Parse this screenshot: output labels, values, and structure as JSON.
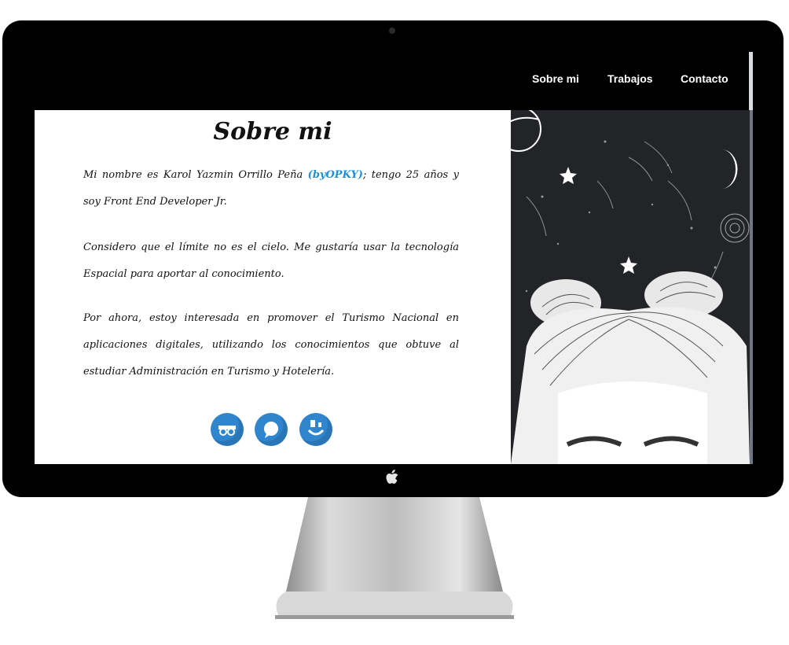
{
  "nav": {
    "items": [
      {
        "label": "Sobre mi"
      },
      {
        "label": "Trabajos"
      },
      {
        "label": "Contacto"
      }
    ]
  },
  "about": {
    "title": "Sobre mi",
    "p1_before": "Mi nombre es Karol Yazmin Orrillo Peña ",
    "p1_brand": "(byOPKY)",
    "p1_after": "; tengo 25 años y soy Front End Developer Jr.",
    "p2": "Considero que el límite no es el cielo. Me gustaría usar la tecnología Espacial para aportar al conocimiento.",
    "p3": "Por ahora, estoy interesada en promover el Turismo Nacional en aplicaciones digitales, utilizando los conocimientos que obtuve al estudiar Administración en Turismo y Hotelería."
  },
  "social": {
    "icons": [
      "github-icon",
      "chat-icon",
      "user-icon"
    ],
    "color": "#2f86cf"
  },
  "colors": {
    "brand_link": "#1f8fd8",
    "navbar": "#000000"
  }
}
